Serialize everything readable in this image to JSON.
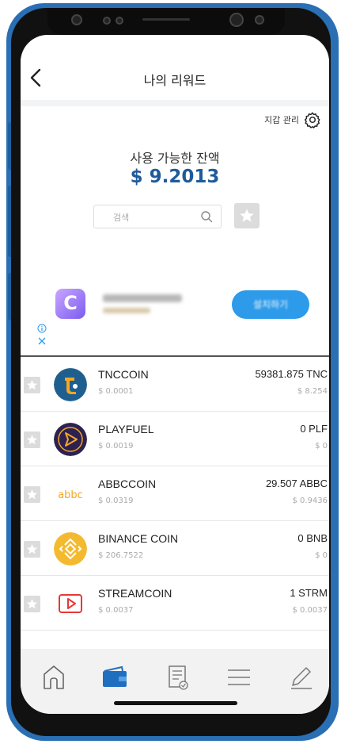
{
  "header": {
    "title": "나의 리워드"
  },
  "wallet": {
    "manage_label": "지갑 관리"
  },
  "balance": {
    "label": "사용 가능한 잔액",
    "value": "$ 9.2013"
  },
  "search": {
    "placeholder": "검색"
  },
  "ad": {
    "logo_letter": "C",
    "install_label": "설치하기"
  },
  "tokens": [
    {
      "name": "TNCCOIN",
      "price": "$ 0.0001",
      "balance": "59381.875 TNC",
      "value": "$ 8.254",
      "icon": "tnc-coin-icon",
      "color": "#1f5f8f"
    },
    {
      "name": "PLAYFUEL",
      "price": "$ 0.0019",
      "balance": "0 PLF",
      "value": "$ 0",
      "icon": "playfuel-coin-icon",
      "color": "#2d2150"
    },
    {
      "name": "ABBCCOIN",
      "price": "$ 0.0319",
      "balance": "29.507 ABBC",
      "value": "$ 0.9436",
      "icon": "abbc-coin-icon",
      "color": "#f5a623"
    },
    {
      "name": "BINANCE COIN",
      "price": "$ 206.7522",
      "balance": "0 BNB",
      "value": "$ 0",
      "icon": "binance-coin-icon",
      "color": "#f3ba2f"
    },
    {
      "name": "STREAMCOIN",
      "price": "$ 0.0037",
      "balance": "1 STRM",
      "value": "$ 0.0037",
      "icon": "streamcoin-icon",
      "color": "#e53935"
    }
  ],
  "tabbar": {
    "items": [
      "home-icon",
      "wallet-icon",
      "receipt-icon",
      "menu-icon",
      "edit-icon"
    ],
    "active_color": "#1f6fc0"
  }
}
